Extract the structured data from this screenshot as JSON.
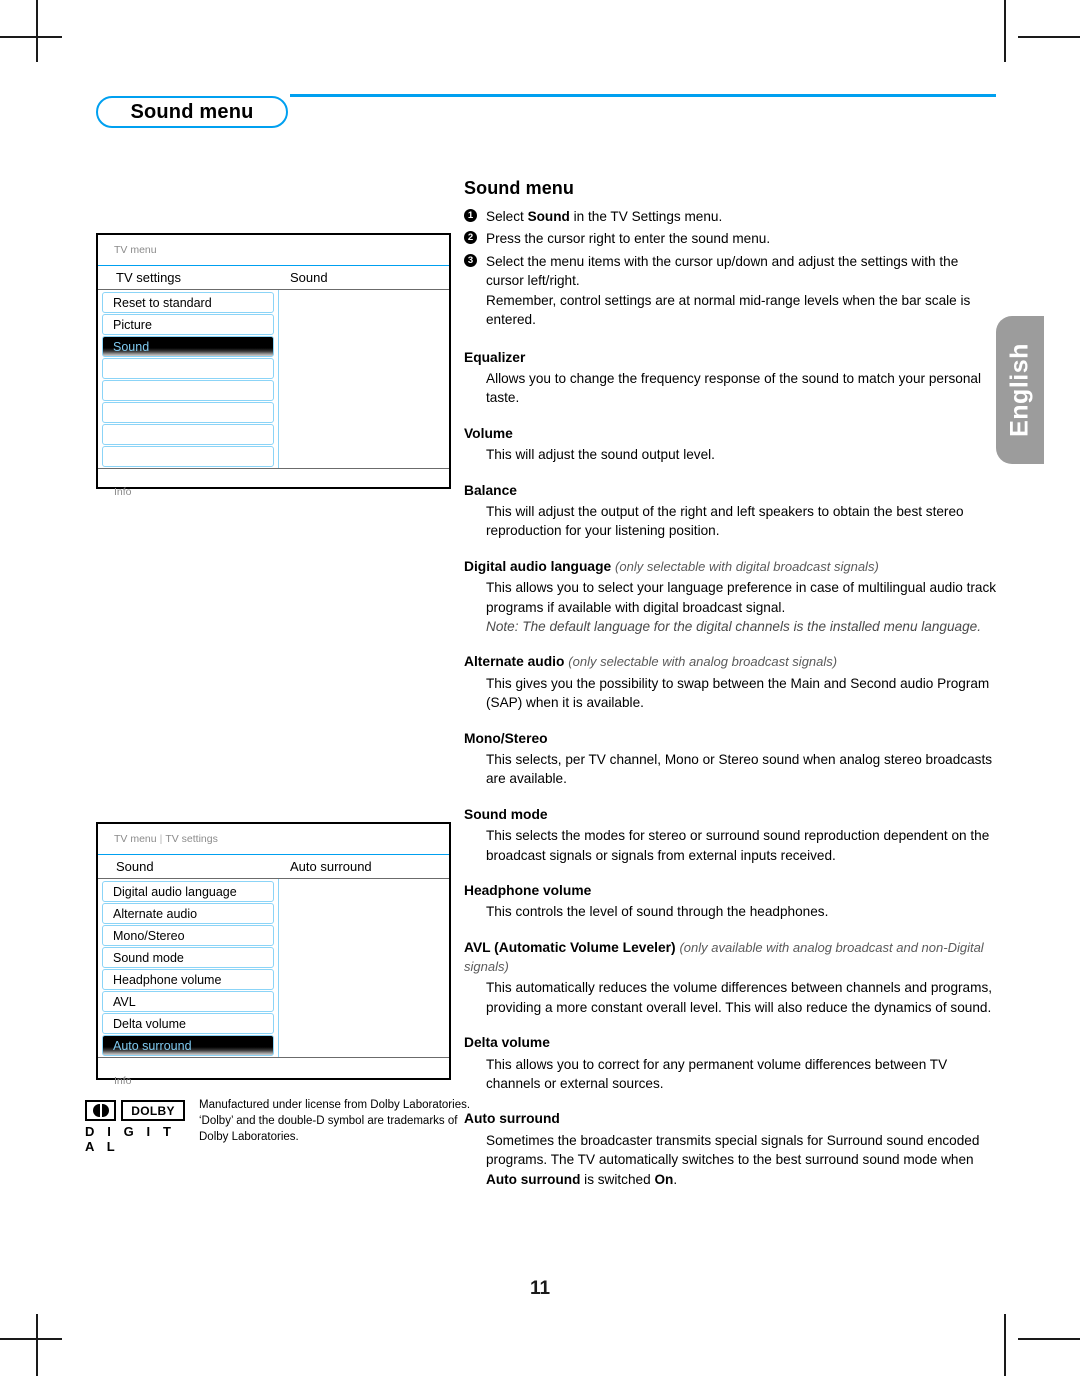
{
  "header": {
    "section_badge": "Sound menu"
  },
  "language_tab": {
    "label": "English"
  },
  "page_number": "11",
  "tv_menu_1": {
    "breadcrumb": "TV menu",
    "left_title": "TV settings",
    "right_title": "Sound",
    "items": [
      {
        "label": "Reset to standard",
        "selected": false
      },
      {
        "label": "Picture",
        "selected": false
      },
      {
        "label": "Sound",
        "selected": true
      },
      {
        "label": "",
        "selected": false
      },
      {
        "label": "",
        "selected": false
      },
      {
        "label": "",
        "selected": false
      },
      {
        "label": "",
        "selected": false
      },
      {
        "label": "",
        "selected": false
      }
    ],
    "footer": "Info"
  },
  "tv_menu_2": {
    "breadcrumb_part1": "TV menu",
    "breadcrumb_part2": "TV settings",
    "left_title": "Sound",
    "right_title": "Auto surround",
    "items": [
      {
        "label": "Digital audio language",
        "selected": false
      },
      {
        "label": "Alternate audio",
        "selected": false
      },
      {
        "label": "Mono/Stereo",
        "selected": false
      },
      {
        "label": "Sound mode",
        "selected": false
      },
      {
        "label": "Headphone volume",
        "selected": false
      },
      {
        "label": "AVL",
        "selected": false
      },
      {
        "label": "Delta volume",
        "selected": false
      },
      {
        "label": "Auto surround",
        "selected": true
      }
    ],
    "footer": "Info"
  },
  "dolby": {
    "mark_word": "DOLBY",
    "digital_word": "D I G I T A L",
    "credit": "Manufactured under license from Dolby Laboratories. ‘Dolby’ and the double-D symbol are trademarks of Dolby Laboratories."
  },
  "main": {
    "title": "Sound menu",
    "steps": [
      {
        "num": "❶",
        "text_pre": "Select ",
        "text_bold": "Sound",
        "text_post": " in the TV Settings menu.",
        "extra": ""
      },
      {
        "num": "❷",
        "text_pre": "Press the cursor right to enter the sound menu.",
        "text_bold": "",
        "text_post": "",
        "extra": ""
      },
      {
        "num": "❸",
        "text_pre": "Select the menu items with the cursor up/down and adjust the settings with the cursor left/right.",
        "text_bold": "",
        "text_post": "",
        "extra": "Remember, control settings are at normal mid-range levels when the bar scale is entered."
      }
    ],
    "sections": [
      {
        "heading": "Equalizer",
        "qualifier": "",
        "body": "Allows you to change the frequency response of the sound to match your personal taste.",
        "note": ""
      },
      {
        "heading": "Volume",
        "qualifier": "",
        "body": "This will adjust the sound output level.",
        "note": ""
      },
      {
        "heading": "Balance",
        "qualifier": "",
        "body": "This will adjust the output of the right and left speakers to obtain the best stereo reproduction for your listening position.",
        "note": ""
      },
      {
        "heading": "Digital audio language",
        "qualifier": "(only selectable with digital broadcast signals)",
        "body": "This allows you to select your language preference in case of multilingual audio track programs if available with digital broadcast signal.",
        "note": "Note: The default language for the digital channels is the installed menu language."
      },
      {
        "heading": "Alternate audio",
        "qualifier": "(only selectable with analog broadcast signals)",
        "body": "This gives you the possibility to swap between the Main and Second audio Program (SAP) when it is available.",
        "note": ""
      },
      {
        "heading": "Mono/Stereo",
        "qualifier": "",
        "body": "This selects, per TV channel, Mono or Stereo sound when analog stereo broadcasts are available.",
        "note": ""
      },
      {
        "heading": "Sound mode",
        "qualifier": "",
        "body": "This selects the modes for stereo or surround sound reproduction dependent on the broadcast signals or signals from external inputs received.",
        "note": ""
      },
      {
        "heading": "Headphone volume",
        "qualifier": "",
        "body": "This controls the level of sound through the headphones.",
        "note": ""
      },
      {
        "heading": "AVL (Automatic Volume Leveler)",
        "qualifier": "(only available with analog broadcast and non-Digital signals)",
        "body": "This automatically reduces the volume differences between channels and programs, providing a more constant overall level. This will also reduce the dynamics of sound.",
        "note": ""
      },
      {
        "heading": "Delta volume",
        "qualifier": "",
        "body": "This allows you to correct for any permanent volume differences between TV channels or external sources.",
        "note": ""
      }
    ],
    "auto_surround": {
      "heading": "Auto surround",
      "body_pre": "Sometimes the broadcaster transmits special signals for Surround sound encoded programs. The TV automatically switches to the best surround sound mode when ",
      "body_bold1": "Auto surround",
      "body_mid": " is switched ",
      "body_bold2": "On",
      "body_end": "."
    }
  },
  "colors": {
    "accent_blue": "#00a0f0",
    "menu_border_blue": "#8bd4f7",
    "tab_gray": "#9c9c9c",
    "selected_text_blue": "#7fc9ef"
  }
}
